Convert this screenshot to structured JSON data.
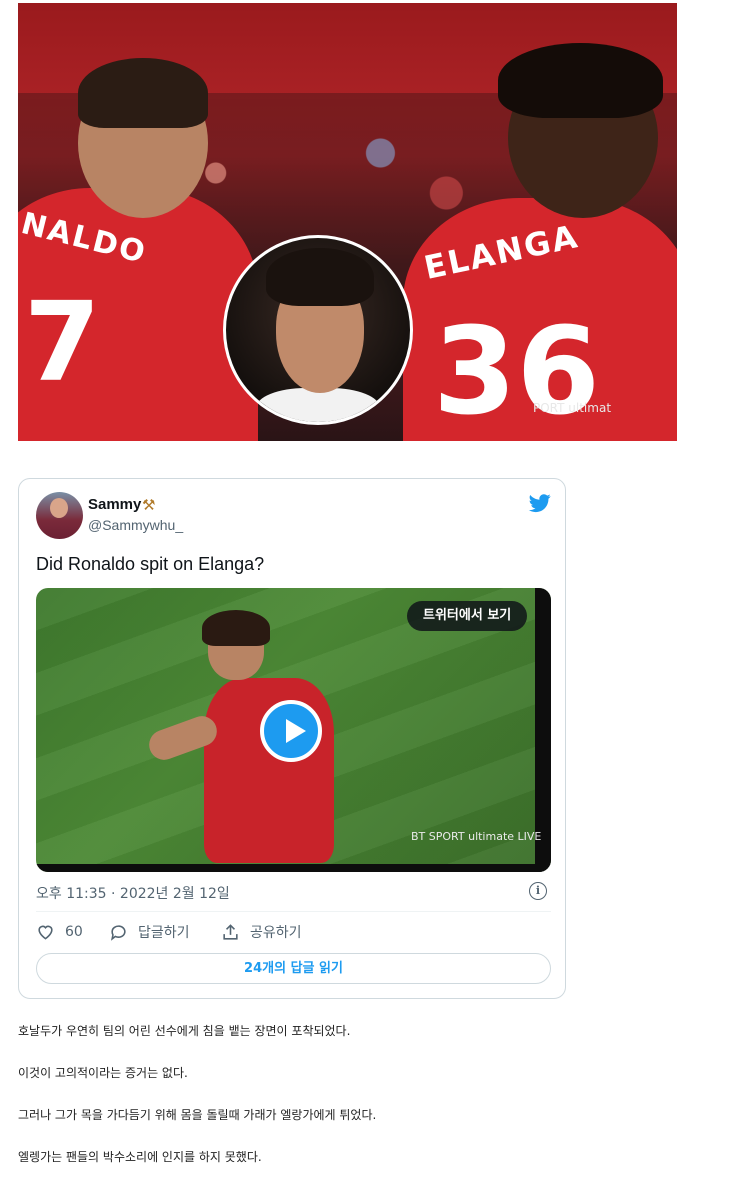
{
  "hero_image": {
    "left_jersey_name": "NALDO",
    "left_jersey_number": "7",
    "right_jersey_name": "ELANGA",
    "right_jersey_number": "36",
    "broadcaster_text": "PORT ultimat"
  },
  "tweet": {
    "author_name": "Sammy",
    "author_emoji": "⚒",
    "author_handle": "@Sammywhu_",
    "text": "Did Ronaldo spit on Elanga?",
    "media": {
      "view_on_twitter_label": "트위터에서 보기",
      "broadcaster_text": "BT SPORT ultimate LIVE"
    },
    "timestamp": "오후 11:35 · 2022년 2월 12일",
    "likes_count": "60",
    "reply_label": "답글하기",
    "share_label": "공유하기",
    "read_replies_label": "24개의 답글 읽기",
    "colors": {
      "accent": "#1d9bf0",
      "muted": "#536471",
      "border": "#cfd9de"
    }
  },
  "article": {
    "paragraphs": [
      "호날두가 우연히 팀의 어린 선수에게 침을 뱉는 장면이 포착되었다.",
      "이것이 고의적이라는 증거는 없다.",
      "그러나 그가 목을 가다듬기 위해 몸을 돌릴때 가래가 엘랑가에게 튀었다.",
      "엘렝가는 팬들의 박수소리에 인지를 하지 못했다."
    ]
  }
}
